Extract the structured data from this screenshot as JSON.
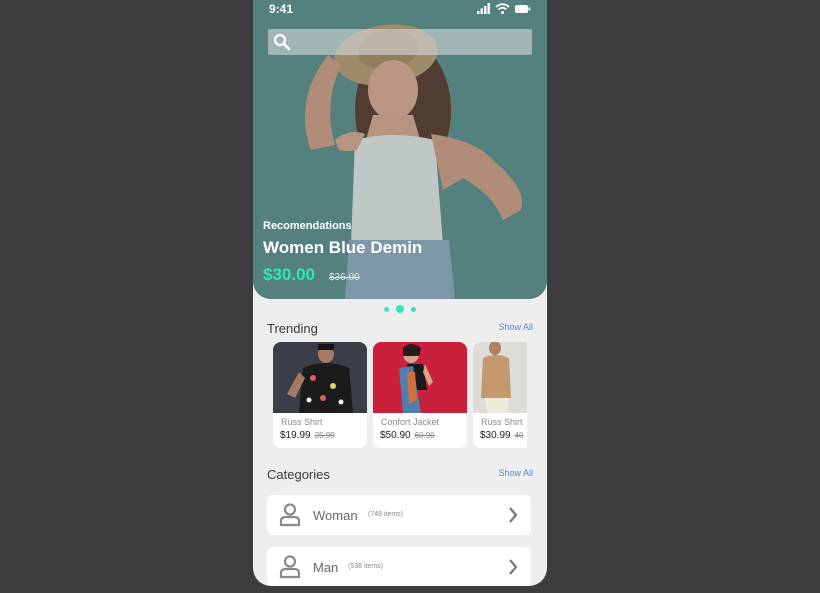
{
  "status": {
    "time": "9:41"
  },
  "search": {
    "placeholder": ""
  },
  "hero": {
    "label": "Recomendations",
    "title": "Women Blue Demin",
    "price": "$30.00",
    "old_price": "$36.00",
    "slide_count": 3,
    "active_slide": 2
  },
  "trending": {
    "title": "Trending",
    "show_all": "Show All",
    "items": [
      {
        "name": "Russ Shirt",
        "price": "$19.99",
        "old_price": "25.99"
      },
      {
        "name": "Confort Jacket",
        "price": "$50.90",
        "old_price": "60.90"
      },
      {
        "name": "Russ Shirt",
        "price": "$30.99",
        "old_price": "40"
      }
    ]
  },
  "categories": {
    "title": "Categories",
    "show_all": "Show All",
    "items": [
      {
        "name": "Woman",
        "count": "(748 items)"
      },
      {
        "name": "Man",
        "count": "(538 items)"
      }
    ]
  },
  "colors": {
    "accent": "#2ee6b8",
    "link": "#4a90d9",
    "background": "#3c3c3c",
    "card_bg": "#ffffff"
  }
}
